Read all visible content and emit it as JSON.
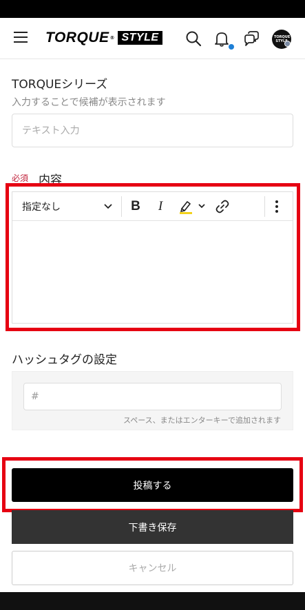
{
  "header": {
    "logo_main": "TORQUE",
    "logo_reg": "®",
    "logo_style": "STYLE",
    "avatar_text": "TORQUE STYLE"
  },
  "series": {
    "title": "TORQUEシリーズ",
    "hint": "入力することで候補が表示されます",
    "placeholder": "テキスト入力",
    "value": ""
  },
  "content": {
    "required_badge": "必須",
    "label": "内容",
    "format_select": "指定なし",
    "bold_label": "B",
    "italic_label": "I",
    "counter_text": ""
  },
  "hashtag": {
    "title": "ハッシュタグの設定",
    "placeholder": "#",
    "hint": "スペース、またはエンターキーで追加されます"
  },
  "actions": {
    "post_label": "投稿する",
    "draft_label": "下書き保存",
    "cancel_label": "キャンセル"
  },
  "colors": {
    "accent_notification": "#1e7fd6",
    "required": "#c0223b",
    "highlight_frame": "#e60012",
    "highlighter": "#f2d21b"
  }
}
